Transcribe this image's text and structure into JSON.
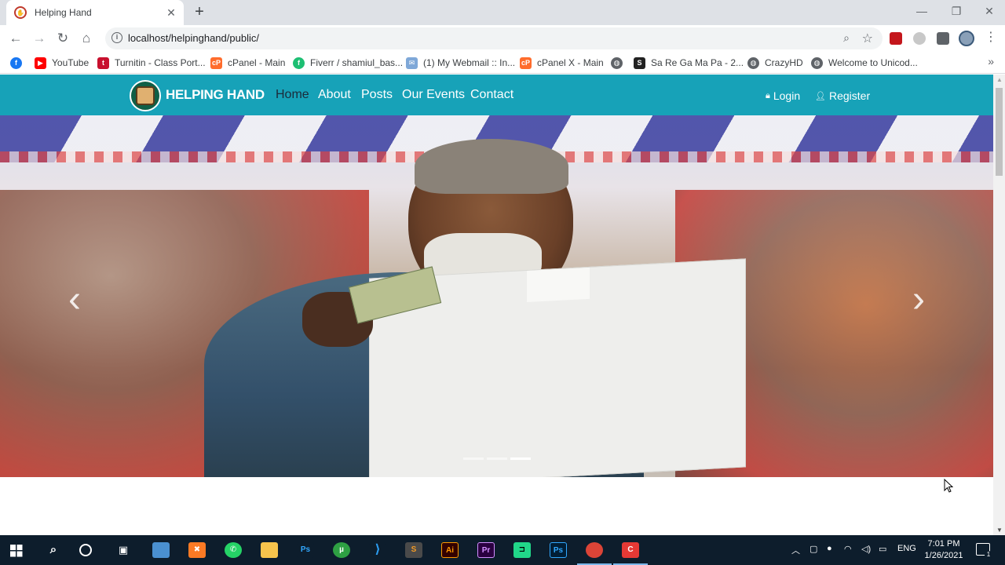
{
  "browser": {
    "tab_title": "Helping Hand",
    "url": "localhost/helpinghand/public/",
    "bookmarks": [
      {
        "label": "",
        "icon": "facebook-icon",
        "color": "#1877f2"
      },
      {
        "label": "YouTube",
        "icon": "youtube-icon",
        "color": "#ff0000"
      },
      {
        "label": "Turnitin - Class Port...",
        "icon": "turnitin-icon",
        "color": "#c8102e"
      },
      {
        "label": "cPanel - Main",
        "icon": "cpanel-icon",
        "color": "#ff6c2c"
      },
      {
        "label": "Fiverr / shamiul_bas...",
        "icon": "fiverr-icon",
        "color": "#1dbf73"
      },
      {
        "label": "(1) My Webmail :: In...",
        "icon": "webmail-icon",
        "color": "#7fa8d8"
      },
      {
        "label": "cPanel X - Main",
        "icon": "cpanel-icon",
        "color": "#ff6c2c"
      },
      {
        "label": "",
        "icon": "globe-icon",
        "color": "#5f6368"
      },
      {
        "label": "Sa Re Ga Ma Pa - 2...",
        "icon": "saregamapa-icon",
        "color": "#222222"
      },
      {
        "label": "CrazyHD",
        "icon": "globe-icon",
        "color": "#5f6368"
      },
      {
        "label": "Welcome to Unicod...",
        "icon": "globe-icon",
        "color": "#5f6368"
      }
    ]
  },
  "site": {
    "brand": "HELPING HAND",
    "nav": [
      "Home",
      "About",
      "Posts",
      "Our Events",
      "Contact"
    ],
    "login": "Login",
    "register": "Register",
    "accent": "#17a2b8",
    "carousel": {
      "slides": 3,
      "active_slide": 3
    }
  },
  "taskbar": {
    "lang": "ENG",
    "time": "7:01 PM",
    "date": "1/26/2021",
    "notification_count": "1"
  }
}
